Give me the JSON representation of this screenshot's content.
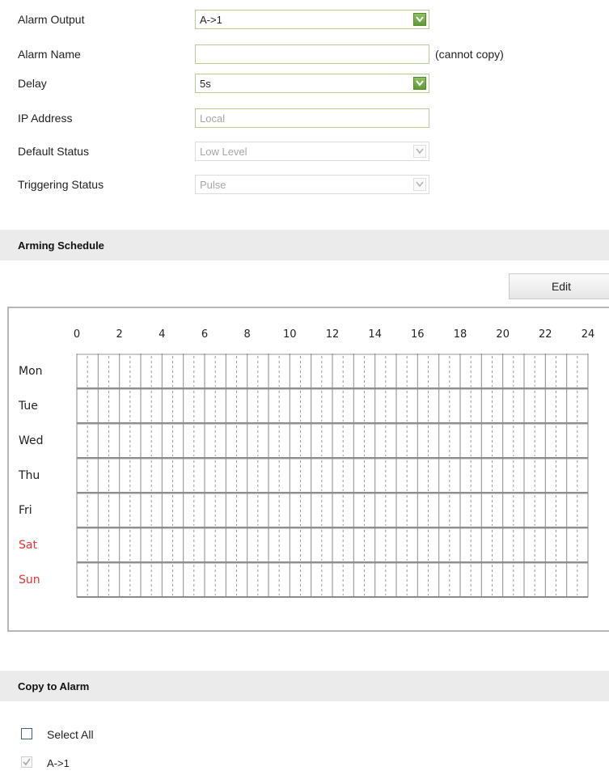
{
  "form": {
    "alarm_output": {
      "label": "Alarm Output",
      "value": "A->1"
    },
    "alarm_name": {
      "label": "Alarm Name",
      "value": "",
      "note": "(cannot copy)"
    },
    "delay": {
      "label": "Delay",
      "value": "5s"
    },
    "ip_address": {
      "label": "IP Address",
      "value": "Local"
    },
    "default_status": {
      "label": "Default Status",
      "value": "Low Level"
    },
    "triggering_status": {
      "label": "Triggering Status",
      "value": "Pulse"
    }
  },
  "arming_schedule": {
    "title": "Arming Schedule",
    "edit_label": "Edit",
    "hours": [
      "0",
      "2",
      "4",
      "6",
      "8",
      "10",
      "12",
      "14",
      "16",
      "18",
      "20",
      "22",
      "24"
    ],
    "days": [
      {
        "label": "Mon",
        "weekend": false
      },
      {
        "label": "Tue",
        "weekend": false
      },
      {
        "label": "Wed",
        "weekend": false
      },
      {
        "label": "Thu",
        "weekend": false
      },
      {
        "label": "Fri",
        "weekend": false
      },
      {
        "label": "Sat",
        "weekend": true
      },
      {
        "label": "Sun",
        "weekend": true
      }
    ],
    "weekend_color": "#e8332f"
  },
  "copy_to_alarm": {
    "title": "Copy to Alarm",
    "select_all_label": "Select All",
    "select_all_checked": false,
    "items": [
      {
        "label": "A->1",
        "checked": true,
        "disabled": true
      }
    ]
  },
  "colors": {
    "accent_green": "#6aa73f",
    "field_border": "#b7cf97",
    "section_bg": "#ebebeb"
  },
  "icons": {
    "dropdown": "chevron-down-icon",
    "checkmark": "check-icon"
  }
}
